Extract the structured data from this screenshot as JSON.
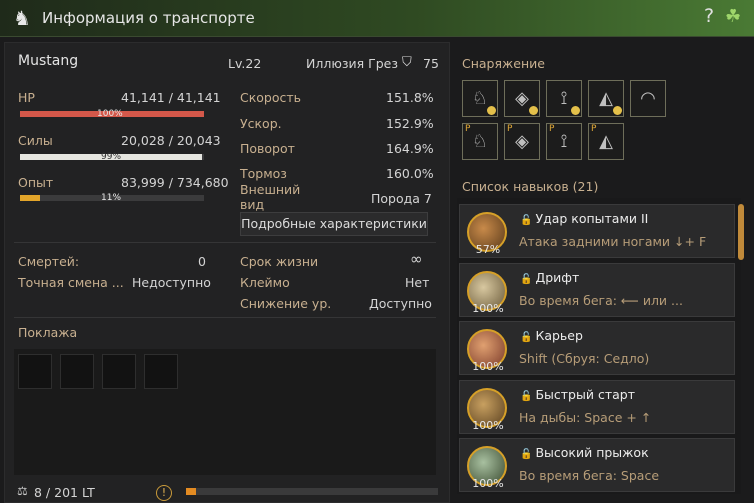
{
  "window": {
    "title": "Информация о транспорте",
    "logo_icon": "horse-head-icon",
    "help": "?",
    "clover_icon": "four-leaf-clover-icon"
  },
  "horse": {
    "name": "Mustang",
    "level": "Lv.22",
    "illusion_label": "Иллюзия Грез",
    "illusion_value": "75"
  },
  "stats": {
    "hp": {
      "label": "HP",
      "value": "41,141 / 41,141",
      "pct": "100%",
      "fraction": 1.0
    },
    "stamina": {
      "label": "Силы",
      "value": "20,028 / 20,043",
      "pct": "99%",
      "fraction": 0.99
    },
    "exp": {
      "label": "Опыт",
      "value": "83,999 / 734,680",
      "pct": "11%",
      "fraction": 0.11
    }
  },
  "attributes": [
    {
      "label": "Скорость",
      "value": "151.8%"
    },
    {
      "label": "Ускор.",
      "value": "152.9%"
    },
    {
      "label": "Поворот",
      "value": "164.9%"
    },
    {
      "label": "Тормоз",
      "value": "160.0%"
    }
  ],
  "appearance": {
    "label": "Внешний вид",
    "value": "Порода 7"
  },
  "details_button": "Подробные характеристики",
  "info": {
    "deaths_label": "Смертей:",
    "deaths_value": "0",
    "swap_label": "Точная смена ...",
    "swap_value": "Недоступно",
    "life_label": "Срок жизни",
    "life_value": "∞",
    "brand_label": "Клеймо",
    "brand_value": "Нет",
    "reduce_label": "Снижение ур.",
    "reduce_value": "Доступно"
  },
  "cargo": {
    "title": "Поклажа",
    "weight": "8 / 201 LT",
    "weight_fraction": 0.04
  },
  "equipment": {
    "title": "Снаряжение",
    "row1_icons": [
      "barding-icon",
      "saddle-icon",
      "stirrups-icon",
      "champron-icon",
      "horseshoe-icon"
    ],
    "row2_icons": [
      "barding-pearl-icon",
      "saddle-pearl-icon",
      "stirrups-pearl-icon",
      "champron-pearl-icon"
    ],
    "pearl_mark": "P"
  },
  "skills": {
    "title": "Список навыков (21)",
    "items": [
      {
        "name": "Удар копытами II",
        "desc": "Атака задними ногами ↓+ F",
        "pct": "57%"
      },
      {
        "name": "Дрифт",
        "desc": "Во время бега: ⟵ или ...",
        "pct": "100%"
      },
      {
        "name": "Карьер",
        "desc": "Shift (Сбруя: Седло)",
        "pct": "100%"
      },
      {
        "name": "Быстрый старт",
        "desc": "На дыбы: Space + ↑",
        "pct": "100%"
      },
      {
        "name": "Высокий прыжок",
        "desc": "Во время бега: Space",
        "pct": "100%"
      }
    ]
  },
  "colors": {
    "hp": "#d4584a",
    "stamina": "#e6e6e0",
    "exp": "#e3a52a",
    "label": "#c8b090"
  }
}
